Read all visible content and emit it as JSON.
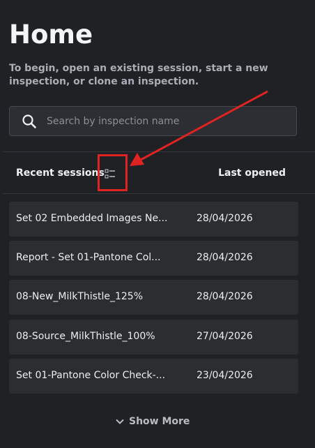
{
  "page": {
    "title": "Home",
    "subtitle": "To begin, open an existing session, start a new inspection, or clone an inspection."
  },
  "search": {
    "placeholder": "Search by inspection name",
    "value": "",
    "icon": "search-icon"
  },
  "table": {
    "headers": {
      "recent": "Recent sessions",
      "last_opened": "Last opened"
    },
    "view_toggle_icon": "list-view-icon",
    "rows": [
      {
        "name": "Set 02 Embedded Images Ne...",
        "date": "28/04/2026"
      },
      {
        "name": "Report - Set 01-Pantone Col...",
        "date": "28/04/2026"
      },
      {
        "name": "08-New_MilkThistle_125%",
        "date": "28/04/2026"
      },
      {
        "name": "08-Source_MilkThistle_100%",
        "date": "27/04/2026"
      },
      {
        "name": "Set 01-Pantone Color Check-...",
        "date": "23/04/2026"
      }
    ]
  },
  "footer": {
    "show_more": "Show More",
    "icon": "chevron-down-icon"
  },
  "colors": {
    "background": "#1f2125",
    "row_background": "#2b2d31",
    "annotation": "#e12222"
  }
}
